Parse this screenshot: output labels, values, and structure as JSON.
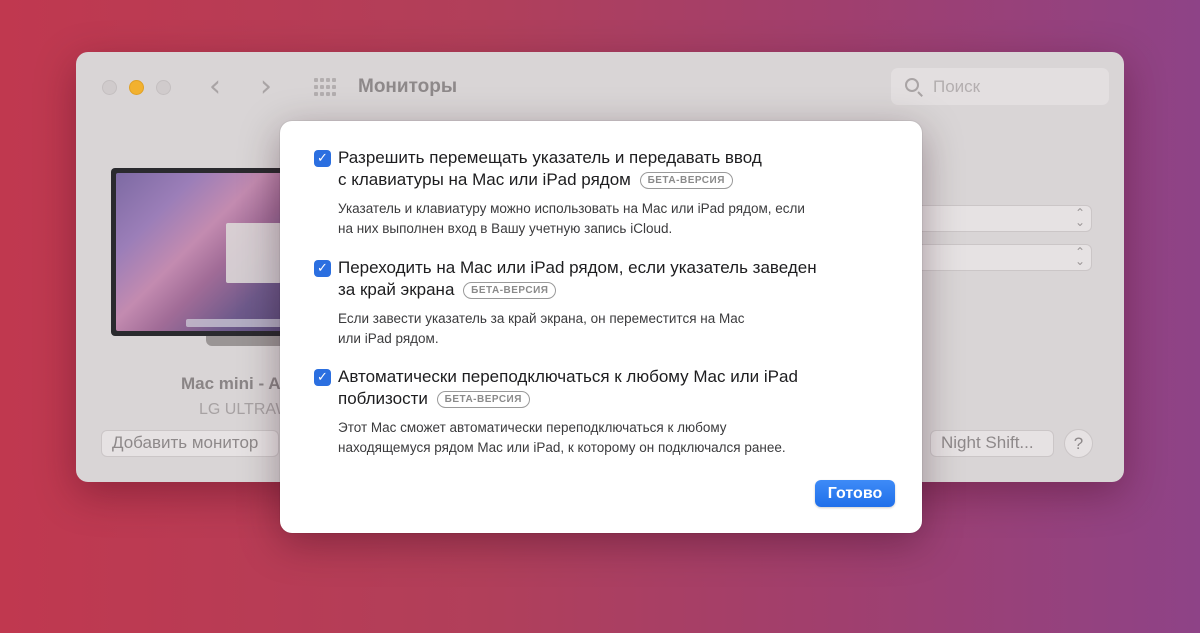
{
  "window": {
    "title": "Мониторы",
    "nav_back": "‹",
    "nav_forward": "›",
    "search_placeholder": "Поиск",
    "display_name": "Mac mini - A",
    "display_model": "LG ULTRAW",
    "add_monitor_label": "Добавить монитор",
    "night_shift_label": "Night Shift...",
    "help_label": "?"
  },
  "sheet": {
    "options": [
      {
        "checked": true,
        "title_line1": "Разрешить перемещать указатель и передавать ввод",
        "title_line2": "с клавиатуры на Mac или iPad рядом",
        "badge": "БЕТА-ВЕРСИЯ",
        "desc_line1": "Указатель и клавиатуру можно использовать на Mac или iPad рядом, если",
        "desc_line2": "на них выполнен вход в Вашу учетную запись iCloud."
      },
      {
        "checked": true,
        "title_line1": "Переходить на Mac или iPad рядом, если указатель заведен",
        "title_line2": "за край экрана",
        "badge": "БЕТА-ВЕРСИЯ",
        "desc_line1": "Если завести указатель за край экрана, он переместится на Mac",
        "desc_line2": "или iPad рядом."
      },
      {
        "checked": true,
        "title_line1": "Автоматически переподключаться к любому Mac или iPad",
        "title_line2": "поблизости",
        "badge": "БЕТА-ВЕРСИЯ",
        "desc_line1": "Этот Mac сможет автоматически переподключаться к любому",
        "desc_line2": "находящемуся рядом Mac или iPad, к которому он подключался ранее."
      }
    ],
    "checkmark": "✓",
    "done_label": "Готово"
  },
  "colors": {
    "accent": "#2b6fe0",
    "minimize": "#f2b12f",
    "background_left": "#c0384f",
    "background_right": "#8e4387"
  },
  "icons": [
    "search-icon",
    "grid-icon",
    "chevron-updown-icon",
    "checkmark-icon"
  ]
}
